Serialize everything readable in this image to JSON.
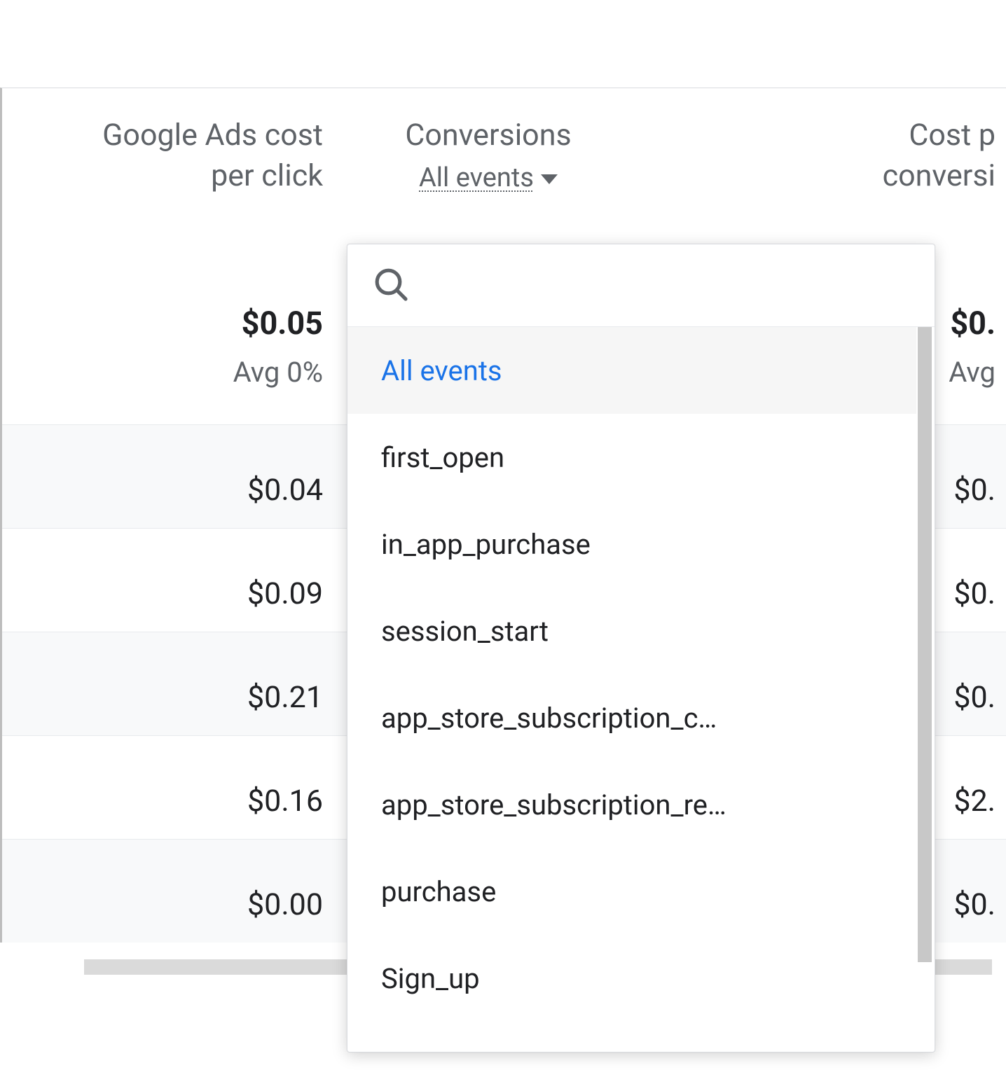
{
  "columns": {
    "cost_per_click": {
      "line1": "Google Ads cost",
      "line2": "per click"
    },
    "conversions": {
      "line1": "Conversions",
      "filter_label": "All events"
    },
    "cost_per_conversion": {
      "line1": "Cost p",
      "line2": "conversi"
    }
  },
  "summary": {
    "cost_per_click": {
      "value": "$0.05",
      "sub": "Avg 0%"
    },
    "cost_per_conversion": {
      "value": "$0.",
      "sub": "Avg"
    }
  },
  "rows": [
    {
      "cost_per_click": "$0.04",
      "cost_per_conversion": "$0."
    },
    {
      "cost_per_click": "$0.09",
      "cost_per_conversion": "$0."
    },
    {
      "cost_per_click": "$0.21",
      "cost_per_conversion": "$0."
    },
    {
      "cost_per_click": "$0.16",
      "cost_per_conversion": "$2."
    },
    {
      "cost_per_click": "$0.00",
      "cost_per_conversion": "$0."
    }
  ],
  "dropdown": {
    "search_placeholder": "",
    "options": [
      {
        "label": "All events",
        "selected": true
      },
      {
        "label": "first_open",
        "selected": false
      },
      {
        "label": "in_app_purchase",
        "selected": false
      },
      {
        "label": "session_start",
        "selected": false
      },
      {
        "label": "app_store_subscription_c…",
        "selected": false
      },
      {
        "label": "app_store_subscription_re…",
        "selected": false
      },
      {
        "label": "purchase",
        "selected": false
      },
      {
        "label": "Sign_up",
        "selected": false
      }
    ]
  }
}
